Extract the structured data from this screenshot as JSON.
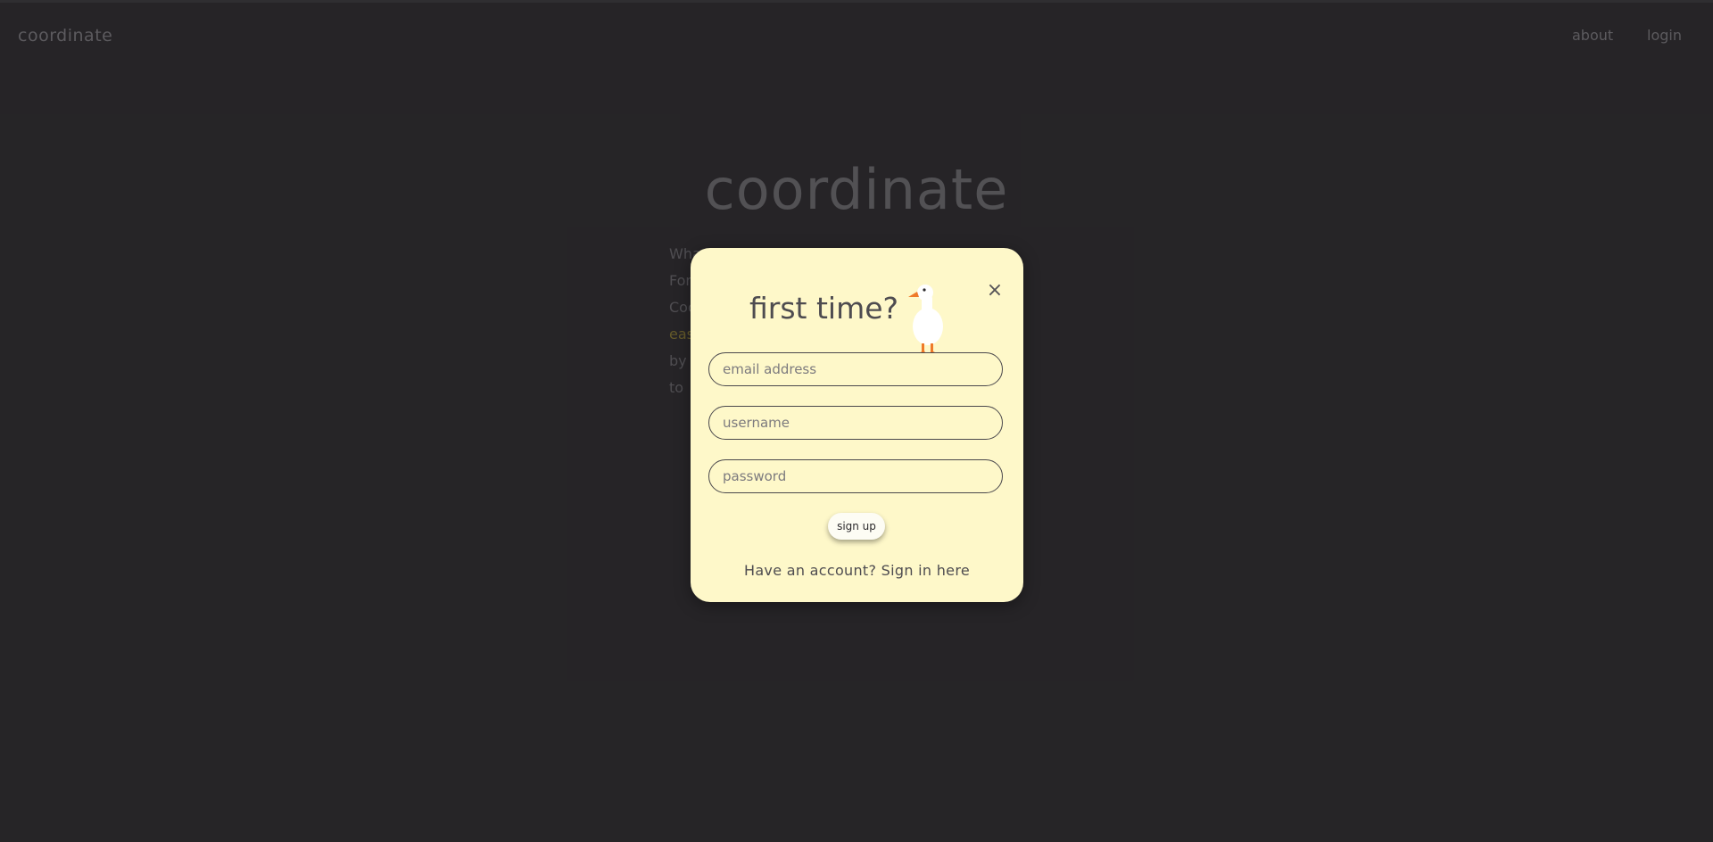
{
  "nav": {
    "brand": "coordinate",
    "about": "about",
    "login": "login"
  },
  "hero": {
    "title": "coordinate",
    "lines": [
      "Wha",
      "For",
      "Coo",
      "eas",
      "by",
      "to"
    ]
  },
  "modal": {
    "title": "first time?",
    "close_symbol": "×",
    "email_placeholder": "email address",
    "username_placeholder": "username",
    "password_placeholder": "password",
    "signup_label": "sign up",
    "signin_text": "Have an account? Sign in here"
  },
  "colors": {
    "background": "#2b292c",
    "modal_bg": "#fef8c9",
    "accent": "#8a7a2f"
  }
}
